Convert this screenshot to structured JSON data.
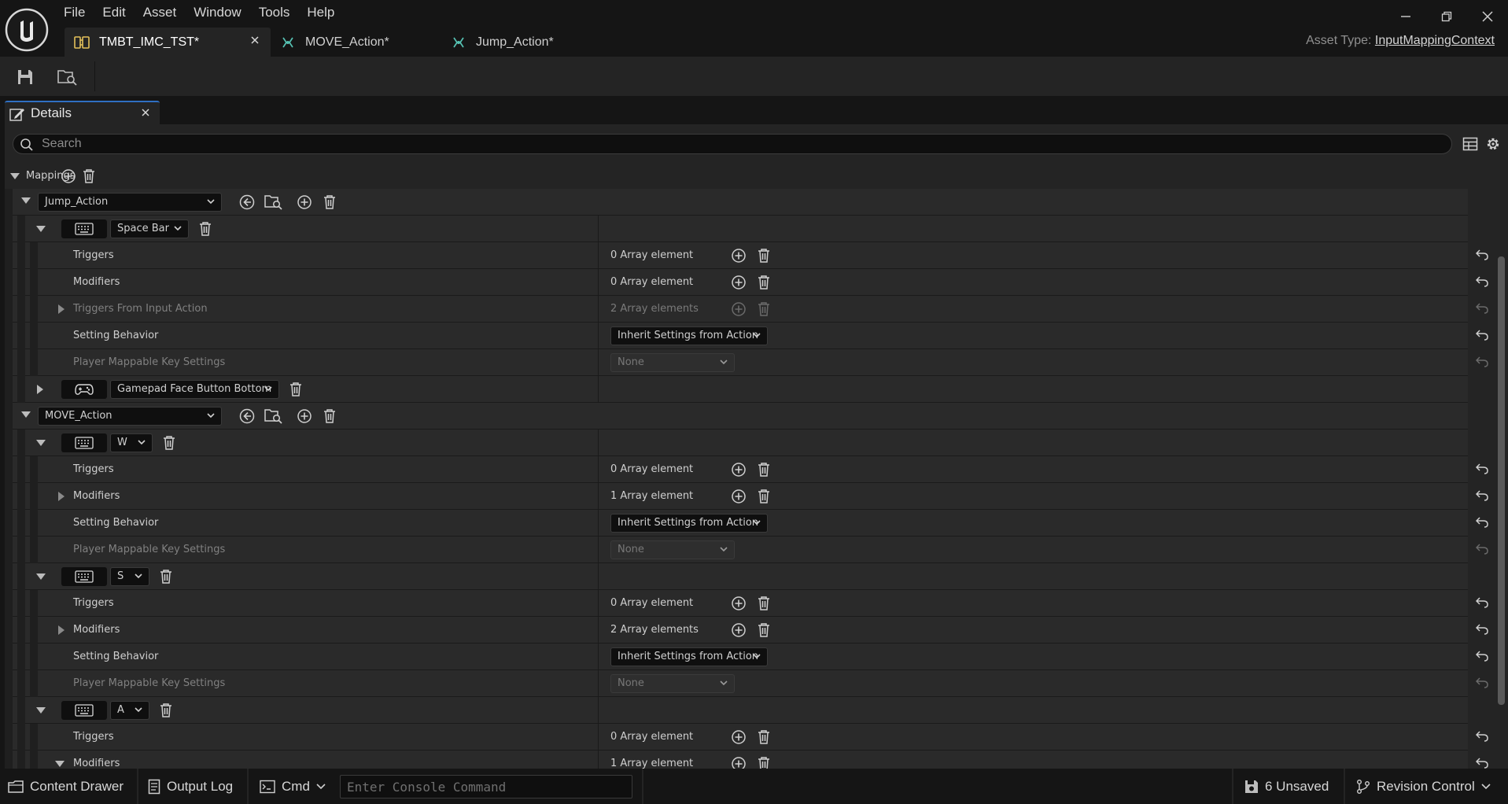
{
  "menu": [
    "File",
    "Edit",
    "Asset",
    "Window",
    "Tools",
    "Help"
  ],
  "tabs": [
    {
      "label": "TMBT_IMC_TST*",
      "active": true
    },
    {
      "label": "MOVE_Action*",
      "active": false
    },
    {
      "label": "Jump_Action*",
      "active": false
    }
  ],
  "asset_type": {
    "label": "Asset Type:",
    "value": "InputMappingContext"
  },
  "details": {
    "tab_label": "Details",
    "search_placeholder": "Search"
  },
  "mappings_label": "Mappings",
  "rows": [
    {
      "kind": "action",
      "label": "Jump_Action"
    },
    {
      "kind": "key",
      "icon": "keyboard",
      "label": "Space Bar",
      "w": 100
    },
    {
      "kind": "prop",
      "label": "Triggers",
      "value": "0 Array element",
      "buttons": true
    },
    {
      "kind": "prop",
      "label": "Modifiers",
      "value": "0 Array element",
      "buttons": true
    },
    {
      "kind": "prop",
      "label": "Triggers From Input Action",
      "value": "2 Array elements",
      "buttons": true,
      "dim": true,
      "expand": true
    },
    {
      "kind": "prop",
      "label": "Setting Behavior",
      "combo": "Inherit Settings from Action"
    },
    {
      "kind": "prop",
      "label": "Player Mappable Key Settings",
      "combo_dim": "None",
      "dim": true
    },
    {
      "kind": "key",
      "icon": "gamepad",
      "label": "Gamepad Face Button Bottom",
      "w": 215,
      "collapsed": true
    },
    {
      "kind": "action",
      "label": "MOVE_Action"
    },
    {
      "kind": "key",
      "icon": "keyboard",
      "label": "W",
      "w": 54
    },
    {
      "kind": "prop",
      "label": "Triggers",
      "value": "0 Array element",
      "buttons": true
    },
    {
      "kind": "prop",
      "label": "Modifiers",
      "value": "1 Array element",
      "buttons": true,
      "expand": true
    },
    {
      "kind": "prop",
      "label": "Setting Behavior",
      "combo": "Inherit Settings from Action"
    },
    {
      "kind": "prop",
      "label": "Player Mappable Key Settings",
      "combo_dim": "None",
      "dim": true
    },
    {
      "kind": "key",
      "icon": "keyboard",
      "label": "S",
      "w": 50
    },
    {
      "kind": "prop",
      "label": "Triggers",
      "value": "0 Array element",
      "buttons": true
    },
    {
      "kind": "prop",
      "label": "Modifiers",
      "value": "2 Array elements",
      "buttons": true,
      "expand": true
    },
    {
      "kind": "prop",
      "label": "Setting Behavior",
      "combo": "Inherit Settings from Action"
    },
    {
      "kind": "prop",
      "label": "Player Mappable Key Settings",
      "combo_dim": "None",
      "dim": true
    },
    {
      "kind": "key",
      "icon": "keyboard",
      "label": "A",
      "w": 50
    },
    {
      "kind": "prop",
      "label": "Triggers",
      "value": "0 Array element",
      "buttons": true
    },
    {
      "kind": "prop",
      "label": "Modifiers",
      "value": "1 Array element",
      "buttons": true,
      "expand": true,
      "expanded": true
    }
  ],
  "statusbar": {
    "content_drawer": "Content Drawer",
    "output_log": "Output Log",
    "cmd": "Cmd",
    "console_placeholder": "Enter Console Command",
    "unsaved": "6 Unsaved",
    "revision_control": "Revision Control"
  }
}
